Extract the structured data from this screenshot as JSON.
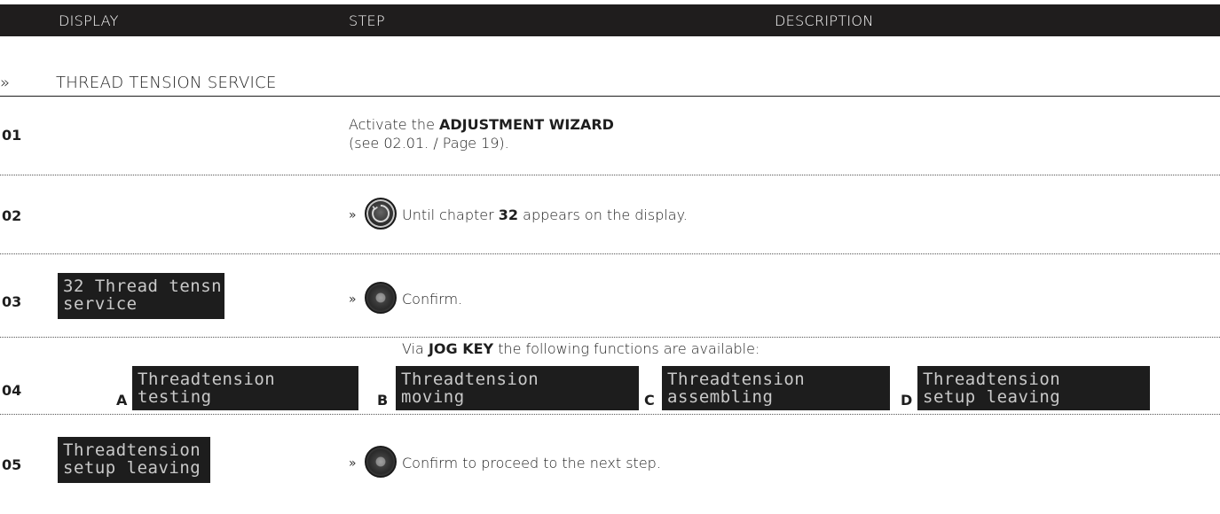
{
  "header": {
    "display": "DISPLAY",
    "step": "STEP",
    "description": "DESCRIPTION"
  },
  "section": {
    "chevron": "»",
    "title": "THREAD TENSION SERVICE"
  },
  "steps": [
    {
      "number": "01",
      "text_before": "Activate the ",
      "text_bold": "ADJUSTMENT WIZARD",
      "text_line2": "(see 02.01. / Page 19)."
    },
    {
      "number": "02",
      "arrow": "»",
      "icon": "jog-dial-icon",
      "text_before": "Until chapter ",
      "text_bold": "32",
      "text_after": " appears on the display."
    },
    {
      "number": "03",
      "display_line1": "32 Thread tensn",
      "display_line2": "service",
      "arrow": "»",
      "icon": "push-button-icon",
      "text": "Confirm."
    },
    {
      "number": "04",
      "text_before": "Via ",
      "text_bold": "JOG KEY",
      "text_after": " the following functions are available:",
      "options": [
        {
          "letter": "A",
          "line1": "Threadtension",
          "line2": "testing"
        },
        {
          "letter": "B",
          "line1": "Threadtension",
          "line2": "moving"
        },
        {
          "letter": "C",
          "line1": "Threadtension",
          "line2": "assembling"
        },
        {
          "letter": "D",
          "line1": "Threadtension",
          "line2": "setup leaving"
        }
      ]
    },
    {
      "number": "05",
      "display_line1": "Threadtension",
      "display_line2": "setup leaving",
      "arrow": "»",
      "icon": "push-button-icon",
      "text": "Confirm to proceed to the next step."
    }
  ]
}
